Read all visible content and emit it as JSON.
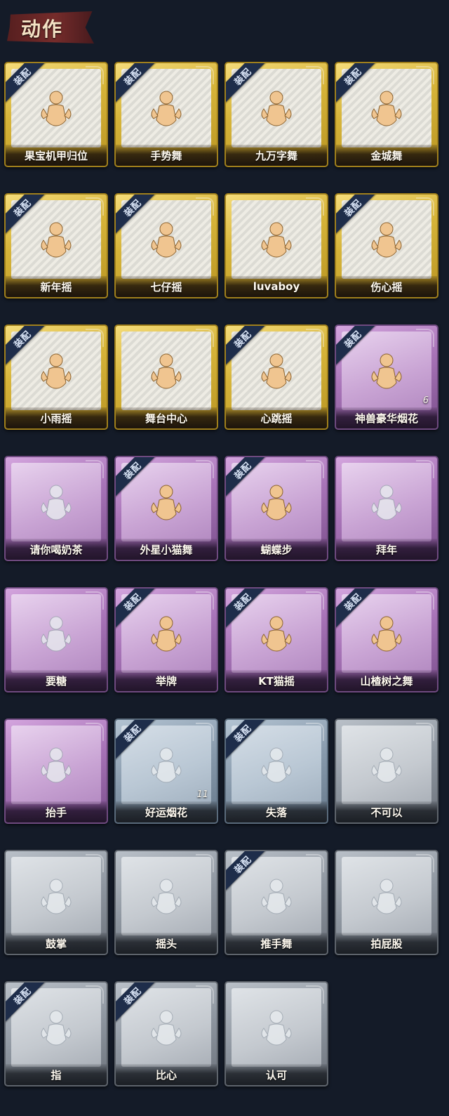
{
  "header": {
    "title": "动作"
  },
  "equip_badge_text": "装配",
  "colors": {
    "gold_frame": "#d7b53a",
    "purple_frame": "#a874b8",
    "gray_frame": "#8e96a0",
    "steel_frame": "#8799ab",
    "badge": "#1e2d4a",
    "background": "#141b28"
  },
  "cards": [
    {
      "label": "果宝机甲归位",
      "rarity": "gold",
      "equipped": true,
      "count": null,
      "icon": "dance-figure-icon"
    },
    {
      "label": "手势舞",
      "rarity": "gold",
      "equipped": true,
      "count": null,
      "icon": "dance-figure-icon"
    },
    {
      "label": "九万字舞",
      "rarity": "gold",
      "equipped": true,
      "count": null,
      "icon": "dance-figure-icon"
    },
    {
      "label": "金城舞",
      "rarity": "gold",
      "equipped": true,
      "count": null,
      "icon": "dance-figure-icon"
    },
    {
      "label": "新年摇",
      "rarity": "gold",
      "equipped": true,
      "count": null,
      "icon": "dance-figure-icon"
    },
    {
      "label": "七仔摇",
      "rarity": "gold",
      "equipped": true,
      "count": null,
      "icon": "dance-figure-icon"
    },
    {
      "label": "luvaboy",
      "rarity": "gold",
      "equipped": false,
      "count": null,
      "icon": "dance-figure-icon"
    },
    {
      "label": "伤心摇",
      "rarity": "gold",
      "equipped": true,
      "count": null,
      "icon": "heart-hands-figure-icon"
    },
    {
      "label": "小雨摇",
      "rarity": "gold",
      "equipped": true,
      "count": null,
      "icon": "dance-figure-icon"
    },
    {
      "label": "舞台中心",
      "rarity": "gold",
      "equipped": false,
      "count": null,
      "icon": "dance-figure-icon"
    },
    {
      "label": "心跳摇",
      "rarity": "gold",
      "equipped": true,
      "count": null,
      "icon": "dance-figure-icon"
    },
    {
      "label": "神兽豪华烟花",
      "rarity": "purple",
      "equipped": true,
      "count": "6",
      "icon": "fireworks-icon"
    },
    {
      "label": "请你喝奶茶",
      "rarity": "purple",
      "equipped": false,
      "count": null,
      "icon": "sign-figure-icon"
    },
    {
      "label": "外星小猫舞",
      "rarity": "purple",
      "equipped": true,
      "count": null,
      "icon": "dance-figure-icon"
    },
    {
      "label": "蝴蝶步",
      "rarity": "purple",
      "equipped": true,
      "count": null,
      "icon": "dance-figure-icon"
    },
    {
      "label": "拜年",
      "rarity": "purple",
      "equipped": false,
      "count": null,
      "icon": "bow-figure-icon"
    },
    {
      "label": "要糖",
      "rarity": "purple",
      "equipped": false,
      "count": null,
      "icon": "reach-figure-icon"
    },
    {
      "label": "举牌",
      "rarity": "purple",
      "equipped": true,
      "count": null,
      "icon": "sign-figure-icon"
    },
    {
      "label": "KT猫摇",
      "rarity": "purple",
      "equipped": true,
      "count": null,
      "icon": "dance-figure-icon"
    },
    {
      "label": "山楂树之舞",
      "rarity": "purple",
      "equipped": true,
      "count": null,
      "icon": "dance-figure-icon"
    },
    {
      "label": "抬手",
      "rarity": "purple",
      "equipped": false,
      "count": null,
      "icon": "reach-figure-icon"
    },
    {
      "label": "好运烟花",
      "rarity": "steel",
      "equipped": true,
      "count": "11",
      "icon": "firework-can-icon"
    },
    {
      "label": "失落",
      "rarity": "steel",
      "equipped": true,
      "count": null,
      "icon": "crawl-figure-icon"
    },
    {
      "label": "不可以",
      "rarity": "gray",
      "equipped": false,
      "count": null,
      "icon": "finger-wag-icon"
    },
    {
      "label": "鼓掌",
      "rarity": "gray",
      "equipped": false,
      "count": null,
      "icon": "clap-hands-icon"
    },
    {
      "label": "摇头",
      "rarity": "gray",
      "equipped": false,
      "count": null,
      "icon": "head-shake-figure-icon"
    },
    {
      "label": "推手舞",
      "rarity": "gray",
      "equipped": true,
      "count": null,
      "icon": "push-hands-figure-icon"
    },
    {
      "label": "拍屁股",
      "rarity": "gray",
      "equipped": false,
      "count": null,
      "icon": "pat-figure-icon"
    },
    {
      "label": "指",
      "rarity": "gray",
      "equipped": true,
      "count": null,
      "icon": "point-hand-icon"
    },
    {
      "label": "比心",
      "rarity": "gray",
      "equipped": true,
      "count": null,
      "icon": "finger-heart-icon"
    },
    {
      "label": "认可",
      "rarity": "gray",
      "equipped": false,
      "count": null,
      "icon": "thumbs-up-icon"
    }
  ]
}
